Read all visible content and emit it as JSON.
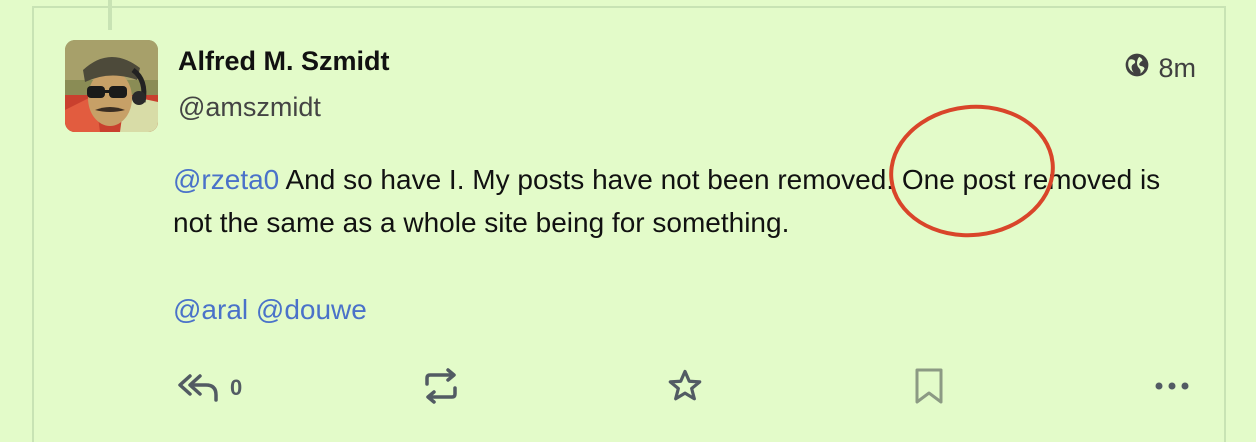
{
  "post": {
    "author": {
      "display_name": "Alfred M. Szmidt",
      "handle": "@amszmidt"
    },
    "visibility_icon": "globe-icon",
    "timestamp": "8m",
    "content": {
      "mention_1": "@rzeta0",
      "line_1_rest": " And so have I.  My posts have not been removed. One post removed is not the same as a whole site being for something.",
      "mention_2": "@aral",
      "mention_3": "@douwe"
    },
    "actions": {
      "reply_icon": "reply-all-icon",
      "reply_count": "0",
      "boost_icon": "boost-icon",
      "favourite_icon": "star-icon",
      "bookmark_icon": "bookmark-icon",
      "more_icon": "more-icon"
    }
  },
  "colors": {
    "background": "#e3fbc9",
    "mention": "#4a72c9",
    "annotation_circle": "#d9452a",
    "icon": "#525b63"
  }
}
